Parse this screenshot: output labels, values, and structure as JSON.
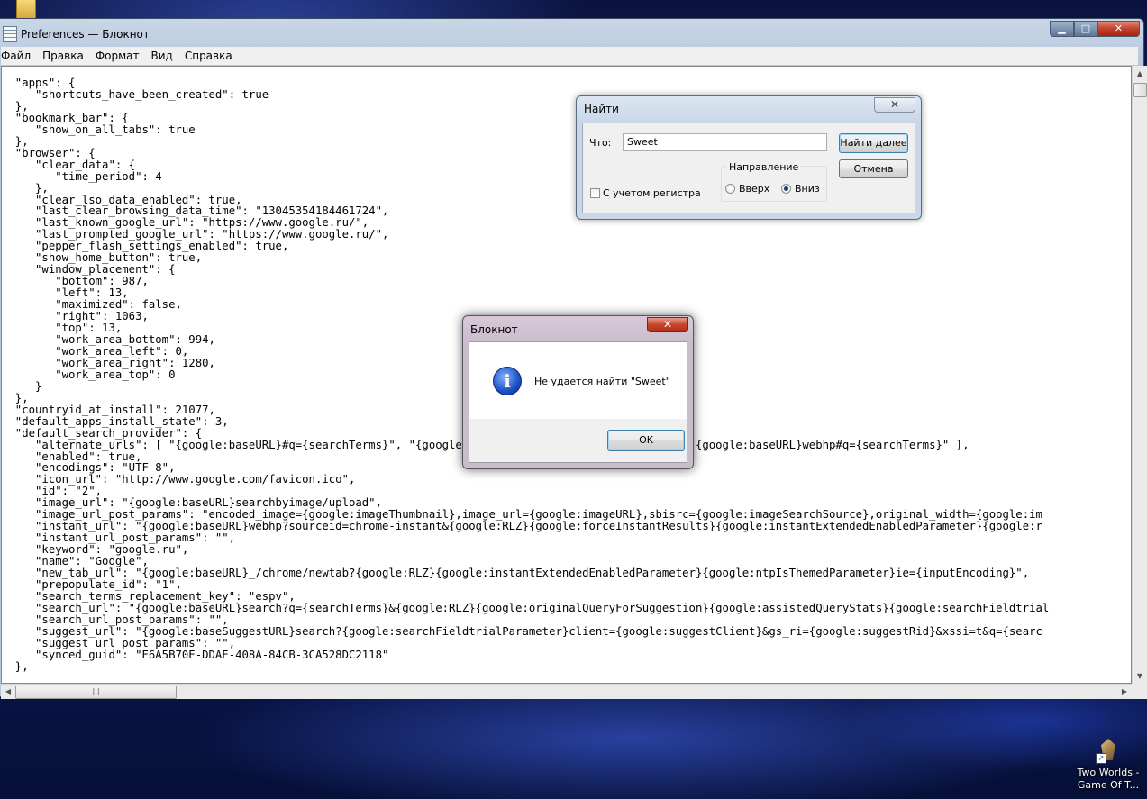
{
  "desktop": {
    "icon_label_line1": "Two Worlds -",
    "icon_label_line2": "Game Of T..."
  },
  "window": {
    "title": "Preferences — Блокнот",
    "menu": [
      "Файл",
      "Правка",
      "Формат",
      "Вид",
      "Справка"
    ],
    "content_lines": [
      "  \"apps\": {",
      "     \"shortcuts_have_been_created\": true",
      "  },",
      "  \"bookmark_bar\": {",
      "     \"show_on_all_tabs\": true",
      "  },",
      "  \"browser\": {",
      "     \"clear_data\": {",
      "        \"time_period\": 4",
      "     },",
      "     \"clear_lso_data_enabled\": true,",
      "     \"last_clear_browsing_data_time\": \"13045354184461724\",",
      "     \"last_known_google_url\": \"https://www.google.ru/\",",
      "     \"last_prompted_google_url\": \"https://www.google.ru/\",",
      "     \"pepper_flash_settings_enabled\": true,",
      "     \"show_home_button\": true,",
      "     \"window_placement\": {",
      "        \"bottom\": 987,",
      "        \"left\": 13,",
      "        \"maximized\": false,",
      "        \"right\": 1063,",
      "        \"top\": 13,",
      "        \"work_area_bottom\": 994,",
      "        \"work_area_left\": 0,",
      "        \"work_area_right\": 1280,",
      "        \"work_area_top\": 0",
      "     }",
      "  },",
      "  \"countryid_at_install\": 21077,",
      "  \"default_apps_install_state\": 3,",
      "  \"default_search_provider\": {",
      "     \"alternate_urls\": [ \"{google:baseURL}#q={searchTerms}\", \"{google:baseURL}search#q={searchTerms}\", \"{google:baseURL}webhp#q={searchTerms}\" ],",
      "     \"enabled\": true,",
      "     \"encodings\": \"UTF-8\",",
      "     \"icon_url\": \"http://www.google.com/favicon.ico\",",
      "     \"id\": \"2\",",
      "     \"image_url\": \"{google:baseURL}searchbyimage/upload\",",
      "     \"image_url_post_params\": \"encoded_image={google:imageThumbnail},image_url={google:imageURL},sbisrc={google:imageSearchSource},original_width={google:im",
      "     \"instant_url\": \"{google:baseURL}webhp?sourceid=chrome-instant&{google:RLZ}{google:forceInstantResults}{google:instantExtendedEnabledParameter}{google:r",
      "     \"instant_url_post_params\": \"\",",
      "     \"keyword\": \"google.ru\",",
      "     \"name\": \"Google\",",
      "     \"new_tab_url\": \"{google:baseURL}_/chrome/newtab?{google:RLZ}{google:instantExtendedEnabledParameter}{google:ntpIsThemedParameter}ie={inputEncoding}\",",
      "     \"prepopulate_id\": \"1\",",
      "     \"search_terms_replacement_key\": \"espv\",",
      "     \"search_url\": \"{google:baseURL}search?q={searchTerms}&{google:RLZ}{google:originalQueryForSuggestion}{google:assistedQueryStats}{google:searchFieldtrial",
      "     \"search_url_post_params\": \"\",",
      "     \"suggest_url\": \"{google:baseSuggestURL}search?{google:searchFieldtrialParameter}client={google:suggestClient}&gs_ri={google:suggestRid}&xssi=t&q={searc",
      "     \"suggest_url_post_params\": \"\",",
      "     \"synced_guid\": \"E6A5B70E-DDAE-408A-84CB-3CA528DC2118\"",
      "  },"
    ]
  },
  "find_dialog": {
    "title": "Найти",
    "what_label": "Что:",
    "what_value": "Sweet",
    "find_next_label": "Найти далее",
    "cancel_label": "Отмена",
    "direction_label": "Направление",
    "up_label": "Вверх",
    "down_label": "Вниз",
    "match_case_label": "С учетом регистра"
  },
  "message_box": {
    "title": "Блокнот",
    "message": "Не удается найти \"Sweet\"",
    "ok_label": "OK"
  }
}
